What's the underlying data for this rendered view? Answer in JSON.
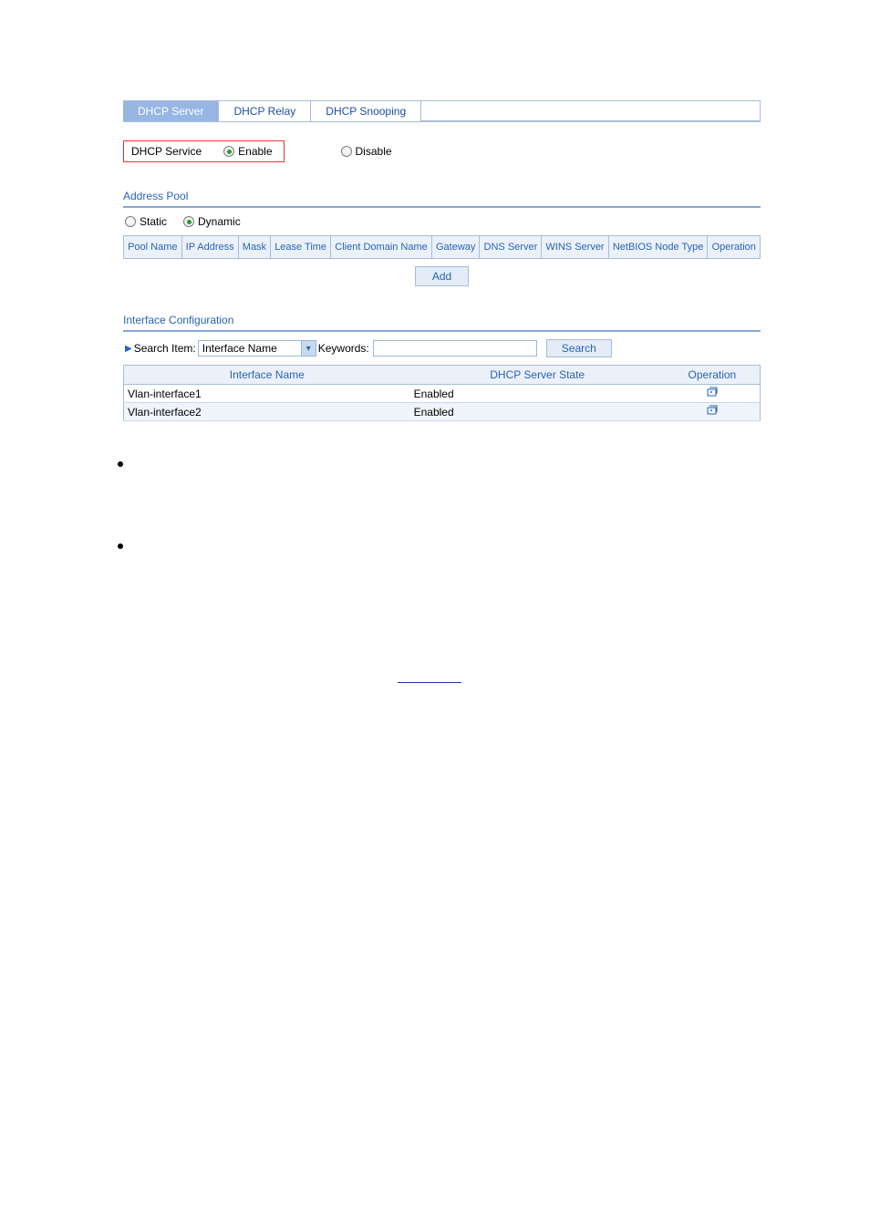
{
  "tabs": [
    "DHCP Server",
    "DHCP Relay",
    "DHCP Snooping"
  ],
  "active_tab": 0,
  "service": {
    "label": "DHCP Service",
    "enable_label": "Enable",
    "disable_label": "Disable",
    "selected": "enable"
  },
  "address_pool": {
    "heading": "Address Pool",
    "mode": {
      "static": "Static",
      "dynamic": "Dynamic",
      "selected": "dynamic"
    },
    "columns": [
      "Pool Name",
      "IP Address",
      "Mask",
      "Lease Time",
      "Client Domain Name",
      "Gateway",
      "DNS Server",
      "WINS Server",
      "NetBIOS Node Type",
      "Operation"
    ],
    "add_label": "Add"
  },
  "interface_cfg": {
    "heading": "Interface Configuration",
    "search_item_label": "Search Item:",
    "search_item_value": "Interface Name",
    "keywords_label": "Keywords:",
    "keywords_value": "",
    "search_label": "Search",
    "columns": [
      "Interface Name",
      "DHCP Server State",
      "Operation"
    ],
    "rows": [
      {
        "name": "Vlan-interface1",
        "state": "Enabled"
      },
      {
        "name": "Vlan-interface2",
        "state": "Enabled"
      }
    ]
  }
}
